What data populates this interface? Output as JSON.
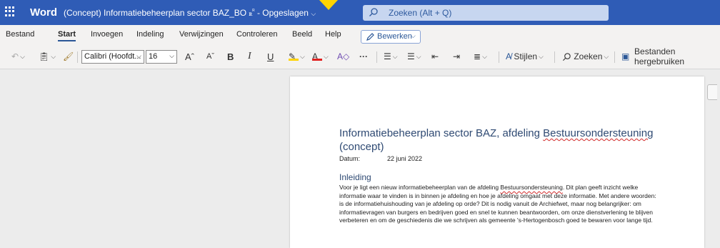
{
  "titlebar": {
    "app_name": "Word",
    "doc_title": "(Concept) Informatiebeheerplan sector BAZ_BO",
    "share_glyph": "ᴿ",
    "status": "- Opgeslagen",
    "search_placeholder": "Zoeken (Alt + Q)"
  },
  "ribbon": {
    "tabs": [
      "Bestand",
      "Start",
      "Invoegen",
      "Indeling",
      "Verwijzingen",
      "Controleren",
      "Beeld",
      "Help"
    ],
    "edit_mode_label": "Bewerken",
    "font_name": "Calibri (Hoofdt...",
    "font_size": "16",
    "styles_label": "Stijlen",
    "find_label": "Zoeken",
    "reuse_label": "Bestanden hergebruiken",
    "highlight_color": "#ffd400",
    "font_color": "#e0201f"
  },
  "document": {
    "title_prefix": "Informatiebeheerplan sector BAZ, afdeling ",
    "title_misspelled": "Bestuursondersteuning",
    "title_suffix": "(concept)",
    "date_label": "Datum:",
    "date_value": "22 juni 2022",
    "section_heading": "Inleiding",
    "intro_prefix": "Voor je ligt een nieuw informatiebeheerplan van de afdeling ",
    "intro_misspelled": "Bestuursondersteuning",
    "intro_rest": ". Dit plan geeft inzicht welke informatie waar te vinden is in binnen je afdeling en hoe je afdeling omgaat met deze informatie. Met andere woorden: is de informatiehuishouding van je afdeling op orde? Dit is nodig vanuit de Archiefwet, maar nog belangrijker: om informatievragen van burgers en bedrijven goed en snel te kunnen beantwoorden, om onze dienstverlening te blijven verbeteren en om de geschiedenis die we schrijven als gemeente 's-Hertogenbosch goed te bewaren voor lange tijd."
  }
}
